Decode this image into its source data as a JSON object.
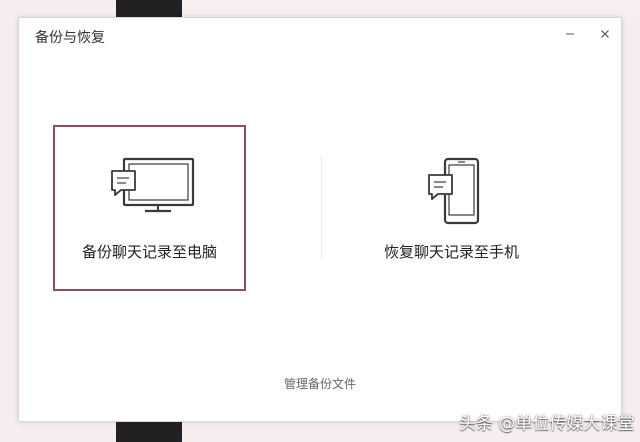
{
  "dialog": {
    "title": "备份与恢复",
    "minimize_icon": "minimize-icon",
    "close_icon": "close-icon"
  },
  "options": [
    {
      "label": "备份聊天记录至电脑",
      "icon": "monitor-chat-icon",
      "selected": true
    },
    {
      "label": "恢复聊天记录至手机",
      "icon": "phone-chat-icon",
      "selected": false
    }
  ],
  "manage_link": "管理备份文件",
  "watermark": "头条 @单位传媒大课堂",
  "colors": {
    "selection_border": "#8c4e5e",
    "background": "#f6eeee"
  }
}
